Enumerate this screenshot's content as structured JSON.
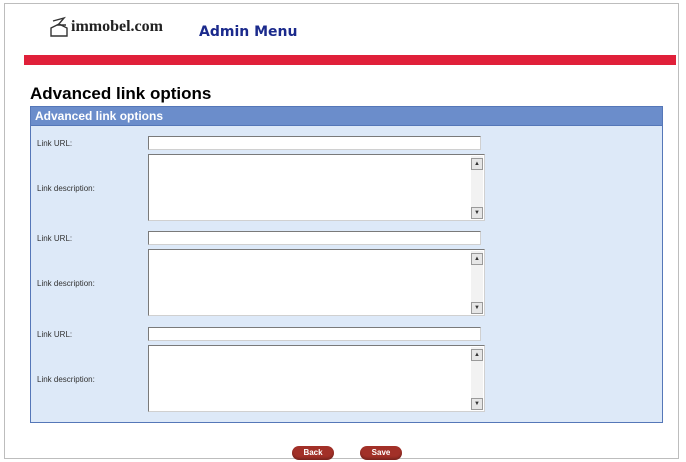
{
  "header": {
    "logo_text": "immobel.com",
    "menu_title": "Admin Menu",
    "accent_color": "#e0203a"
  },
  "page": {
    "title": "Advanced link options"
  },
  "panel": {
    "header": "Advanced link options",
    "links": [
      {
        "url_label": "Link URL:",
        "url_value": "",
        "description_label": "Link description:",
        "description_value": ""
      },
      {
        "url_label": "Link URL:",
        "url_value": "",
        "description_label": "Link description:",
        "description_value": ""
      },
      {
        "url_label": "Link URL:",
        "url_value": "",
        "description_label": "Link description:",
        "description_value": ""
      }
    ]
  },
  "scrollbar": {
    "up_icon": "▲",
    "down_icon": "▼"
  },
  "actions": {
    "back_label": "Back",
    "save_label": "Save"
  }
}
